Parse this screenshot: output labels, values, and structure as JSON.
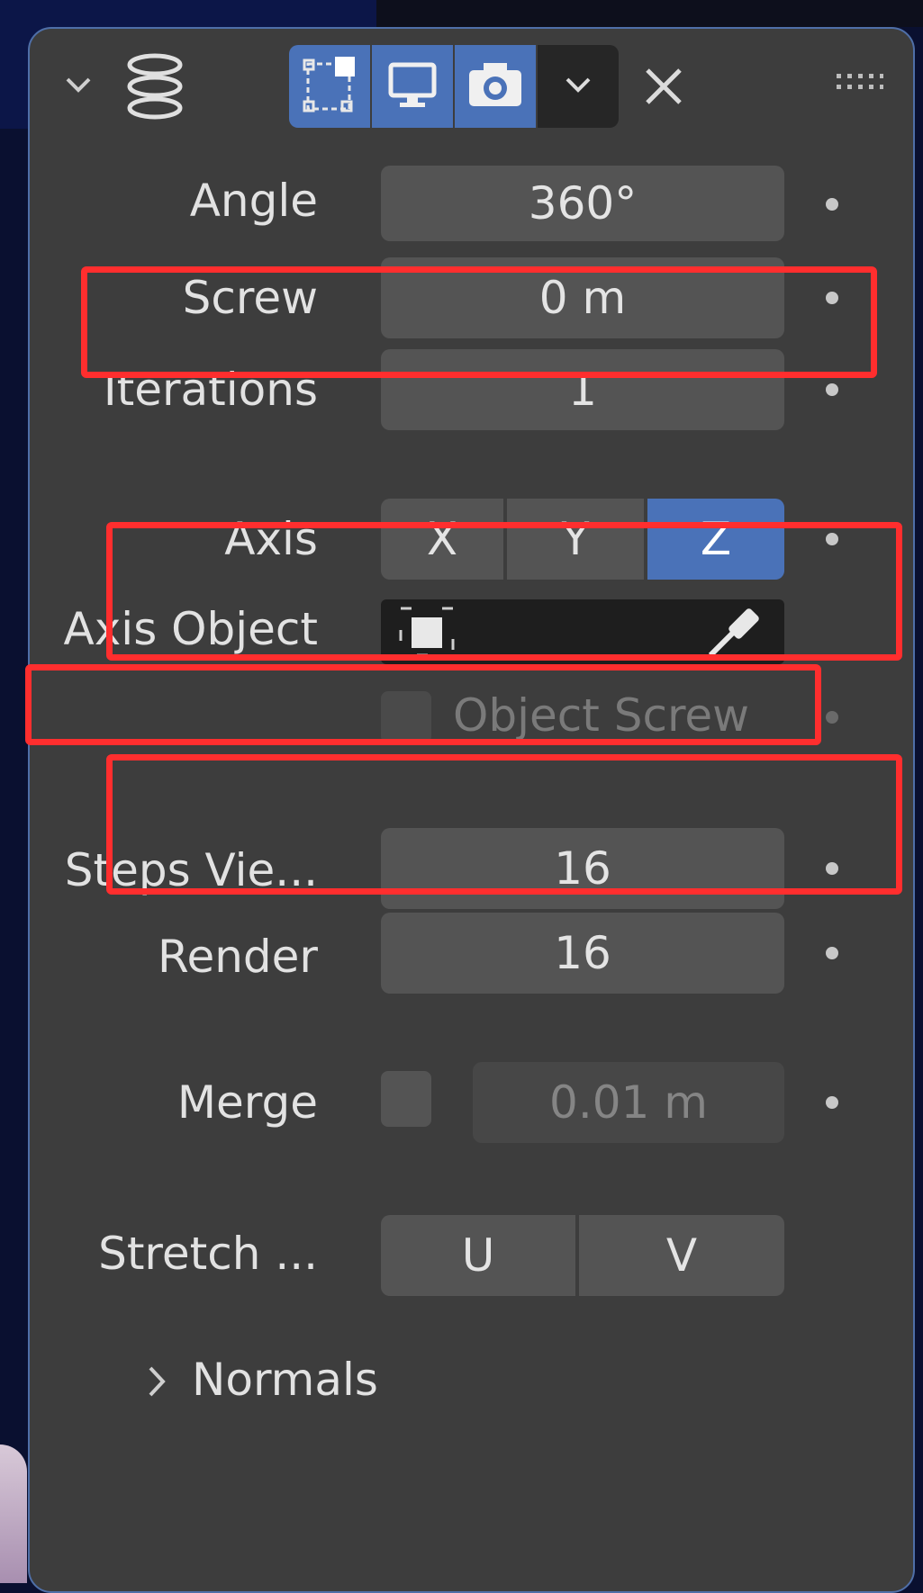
{
  "header": {
    "collapse_icon": "chevron-down-icon",
    "modifier_icon": "screw-modifier-icon",
    "buttons": [
      "edit-mode-icon",
      "viewport-display-icon",
      "render-camera-icon"
    ],
    "dropdown_icon": "chevron-down-icon",
    "close_icon": "close-icon",
    "drag_icon": "drag-handle-icon"
  },
  "properties": {
    "angle": {
      "label": "Angle",
      "value": "360°"
    },
    "screw": {
      "label": "Screw",
      "value": "0 m"
    },
    "iterations": {
      "label": "Iterations",
      "value": "1"
    },
    "axis": {
      "label": "Axis",
      "options": [
        "X",
        "Y",
        "Z"
      ],
      "selected": "Z"
    },
    "axis_object": {
      "label": "Axis Object",
      "value": ""
    },
    "object_screw": {
      "label": "Object Screw",
      "checked": false
    },
    "steps_viewport": {
      "label": "Steps Vie...",
      "value": "16"
    },
    "render": {
      "label": "Render",
      "value": "16"
    },
    "merge": {
      "label": "Merge",
      "value": "0.01 m",
      "checked": false
    },
    "stretch": {
      "label": "Stretch ...",
      "options": [
        "U",
        "V"
      ]
    }
  },
  "subpanel": {
    "normals_label": "Normals"
  },
  "colors": {
    "accent": "#4a72b8",
    "highlight": "#ff2e2e",
    "panel": "#3d3d3d",
    "field": "#545454"
  }
}
